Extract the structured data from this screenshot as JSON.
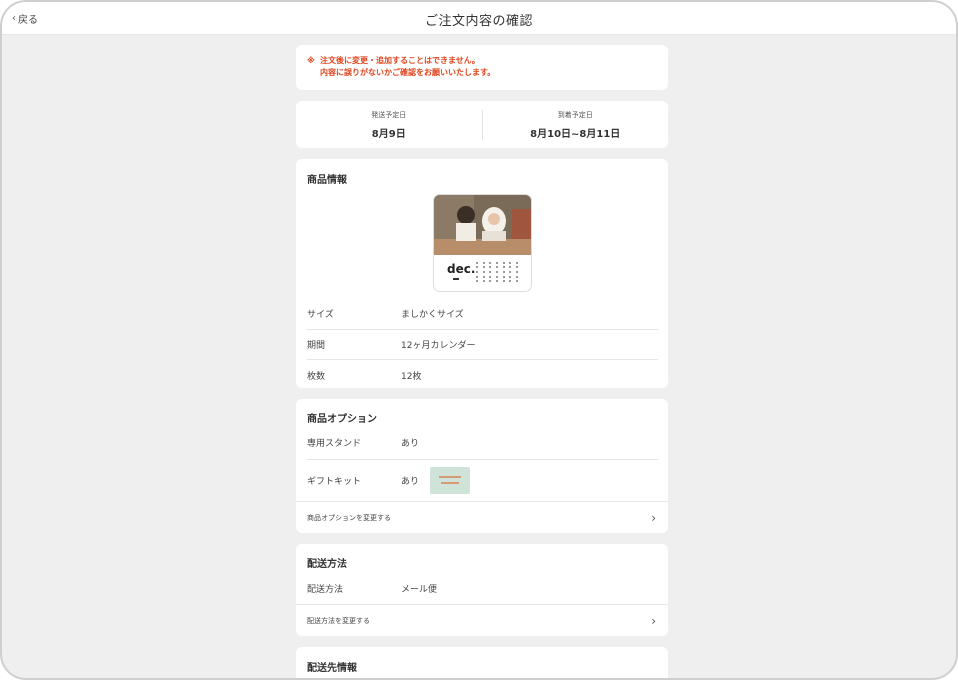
{
  "header": {
    "back_label": "戻る",
    "title": "ご注文内容の確認"
  },
  "notice": {
    "mark": "※",
    "line1": "注文後に変更・追加することはできません。",
    "line2": "内容に誤りがないかご確認をお願いいたします。",
    "color": "#e0451f"
  },
  "dates": {
    "ship_label": "発送予定日",
    "ship_value": "8月9日",
    "arrival_label": "到着予定日",
    "arrival_value": "8月10日~8月11日"
  },
  "product": {
    "title": "商品情報",
    "thumb_word": "dec.",
    "rows": [
      {
        "label": "サイズ",
        "value": "ましかくサイズ"
      },
      {
        "label": "期間",
        "value": "12ヶ月カレンダー"
      },
      {
        "label": "枚数",
        "value": "12枚"
      }
    ]
  },
  "options": {
    "title": "商品オプション",
    "stand_label": "専用スタンド",
    "stand_value": "あり",
    "gift_label": "ギフトキット",
    "gift_value": "あり",
    "change_link": "商品オプションを変更する"
  },
  "shipping": {
    "title": "配送方法",
    "method_label": "配送方法",
    "method_value": "メール便",
    "change_link": "配送方法を変更する"
  },
  "address": {
    "title": "配送先情報"
  },
  "icons": {
    "back": "chevron-left-icon",
    "link": "chevron-right-icon"
  }
}
